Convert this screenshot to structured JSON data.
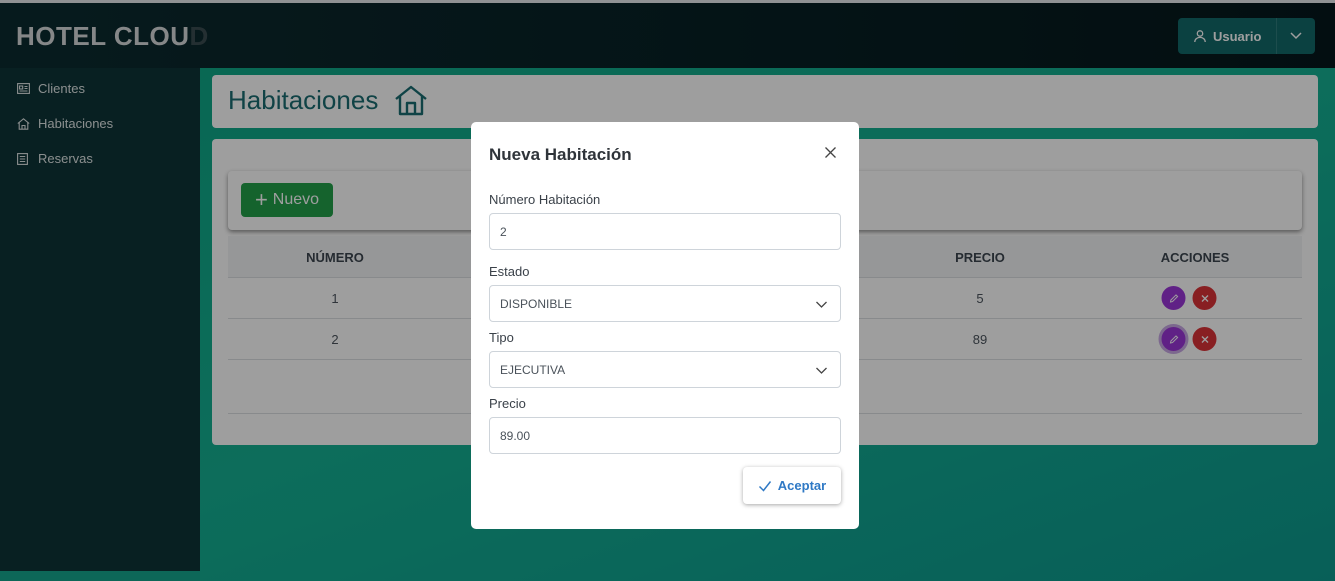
{
  "brand": {
    "main": "HOTEL CLOU",
    "faded": "D"
  },
  "user_menu": {
    "label": "Usuario"
  },
  "sidebar": {
    "items": [
      {
        "label": "Clientes",
        "icon": "id-card-icon"
      },
      {
        "label": "Habitaciones",
        "icon": "home-icon"
      },
      {
        "label": "Reservas",
        "icon": "list-icon"
      }
    ]
  },
  "page": {
    "title": "Habitaciones"
  },
  "toolbar": {
    "new_label": "Nuevo"
  },
  "table": {
    "columns": [
      "NÚMERO",
      "PRECIO",
      "ACCIONES"
    ],
    "rows": [
      {
        "numero": "1",
        "precio": "5"
      },
      {
        "numero": "2",
        "precio": "89"
      }
    ]
  },
  "modal": {
    "title": "Nueva Habitación",
    "fields": {
      "numero": {
        "label": "Número Habitación",
        "value": "2"
      },
      "estado": {
        "label": "Estado",
        "value": "DISPONIBLE"
      },
      "tipo": {
        "label": "Tipo",
        "value": "EJECUTIVA"
      },
      "precio": {
        "label": "Precio",
        "value": "89.00"
      }
    },
    "accept_label": "Aceptar"
  },
  "colors": {
    "accent": "#136a6a",
    "primary_btn": "#22a049",
    "edit": "#9c36d8",
    "delete": "#dc3238",
    "link": "#2f79c5"
  }
}
